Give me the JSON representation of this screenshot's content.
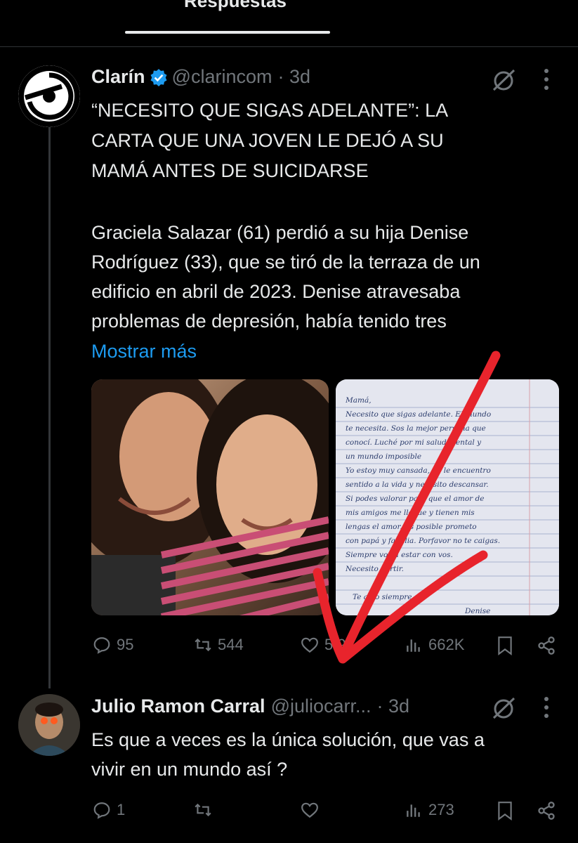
{
  "header": {
    "active_tab": "Respuestas"
  },
  "post": {
    "author_name": "Clarín",
    "handle": "@clarincom",
    "time": "· 3d",
    "headline_lines": [
      "“NECESITO QUE SIGAS ADELANTE”: LA",
      "CARTA QUE UNA JOVEN LE DEJÓ A SU",
      "MAMÁ ANTES DE SUICIDARSE"
    ],
    "body_lines": [
      "Graciela Salazar (61) perdió a su hija Denise",
      "Rodríguez (33), que se tiró de la terraza de un",
      "edificio en abril de 2023. Denise atravesaba",
      "problemas de depresión, había tenido tres"
    ],
    "show_more": "Mostrar más",
    "letter_lines": [
      "Mamá,",
      "Necesito que sigas adelante. El mundo",
      "te necesita. Sos la mejor persona que",
      "conocí. Luché por mi salud mental y",
      "un mundo imposible",
      "Yo estoy muy cansada, no le encuentro",
      "sentido a la vida y necesito descansar.",
      "Si podes valorar para que el amor de",
      "mis amigos me llegue y tienen mis",
      "lengas el amor. Es posible prometo",
      "con papá y familia. Porfavor no te caigas.",
      "Siempre voy a estar con vos.",
      "Necesito partir.",
      "",
      "Te amo siempre,",
      "Denise"
    ],
    "stats": {
      "replies": "95",
      "reposts": "544",
      "likes": "5.9",
      "views": "662K"
    }
  },
  "reply": {
    "author_name": "Julio Ramon Carral",
    "handle": "@juliocarr...",
    "time": "· 3d",
    "text_lines": [
      "Es que a veces es la única solución, que vas a",
      "vivir en un mundo así ?"
    ],
    "stats": {
      "replies": "1",
      "reposts": "",
      "likes": "",
      "views": "273"
    }
  },
  "colors": {
    "accent": "#1d9bf0",
    "annotation_arrow": "#e8242c",
    "muted": "#71767b",
    "background": "#000000"
  },
  "icons": [
    "more-options-icon",
    "grok-icon",
    "reply-icon",
    "repost-icon",
    "like-icon",
    "views-icon",
    "bookmark-icon",
    "share-icon",
    "verified-badge-icon"
  ]
}
